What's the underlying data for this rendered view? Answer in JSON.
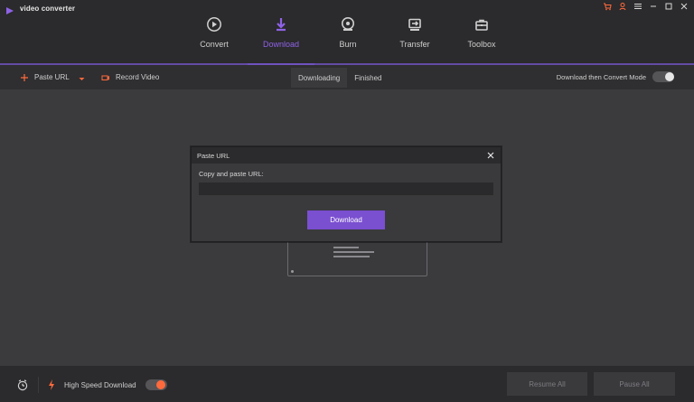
{
  "app": {
    "title": "video converter",
    "colors": {
      "accent": "#8e63e6",
      "bg": "#3b3a3c",
      "panel": "#2b2a2c",
      "high_speed": "#ff6a3d"
    }
  },
  "nav": {
    "tabs": [
      {
        "label": "Convert",
        "icon": "play-circle-icon"
      },
      {
        "label": "Download",
        "icon": "download-arrow-icon",
        "active": true
      },
      {
        "label": "Burn",
        "icon": "disc-burn-icon"
      },
      {
        "label": "Transfer",
        "icon": "transfer-icon"
      },
      {
        "label": "Toolbox",
        "icon": "toolbox-icon"
      }
    ]
  },
  "toolbar": {
    "paste_url_label": "Paste URL",
    "record_video_label": "Record Video",
    "segments": {
      "downloading": "Downloading",
      "finished": "Finished"
    },
    "mode_label": "Download then Convert Mode"
  },
  "modal": {
    "title": "Paste URL",
    "field_label": "Copy and paste URL:",
    "url_value": "",
    "download_label": "Download"
  },
  "bottom": {
    "high_speed_label": "High Speed Download",
    "resume_all_label": "Resume All",
    "pause_all_label": "Pause All"
  }
}
